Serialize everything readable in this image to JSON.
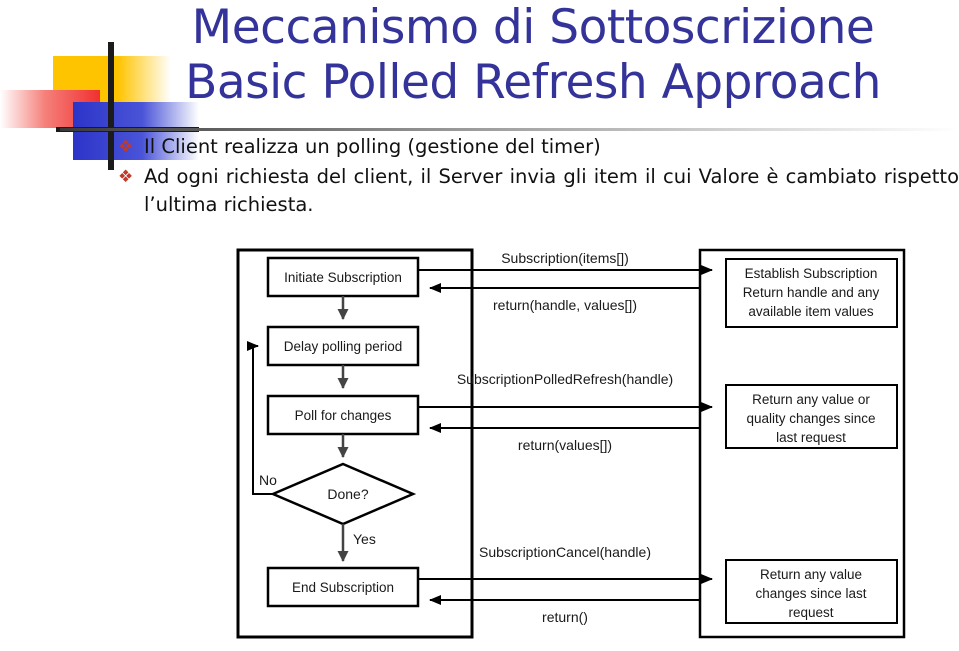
{
  "slide": {
    "title_line_1": "Meccanismo di Sottoscrizione",
    "title_line_2": "Basic Polled Refresh Approach",
    "title_color": "#333399",
    "bullet_color": "#c0392b",
    "bullets": [
      {
        "glyph": "❖",
        "text": "Il Client realizza un polling (gestione del timer)",
        "justified": false
      },
      {
        "glyph": "❖",
        "text": "Ad ogni richiesta del client, il Server invia gli item il cui Valore è cambiato rispetto l’ultima richiesta.",
        "justified": true
      }
    ]
  },
  "diagram": {
    "type": "sequence-flowchart",
    "client_steps": [
      {
        "id": "initiate",
        "label": "Initiate Subscription"
      },
      {
        "id": "delay",
        "label": "Delay polling period"
      },
      {
        "id": "poll",
        "label": "Poll for changes"
      },
      {
        "id": "end",
        "label": "End Subscription"
      }
    ],
    "decision": {
      "id": "done",
      "label": "Done?"
    },
    "branches": {
      "no": "No",
      "yes": "Yes"
    },
    "server_steps": [
      {
        "id": "establish",
        "lines": [
          "Establish Subscription",
          "Return handle and any",
          "available item values"
        ]
      },
      {
        "id": "changes",
        "lines": [
          "Return any value or",
          "quality changes since",
          "last request"
        ]
      },
      {
        "id": "cancel",
        "lines": [
          "Return any value",
          "changes since last",
          "request"
        ]
      }
    ],
    "messages": [
      {
        "id": "m1",
        "label": "Subscription(items[])",
        "direction": "request"
      },
      {
        "id": "m2",
        "label": "return(handle, values[])",
        "direction": "response"
      },
      {
        "id": "m3",
        "label": "SubscriptionPolledRefresh(handle)",
        "direction": "request"
      },
      {
        "id": "m4",
        "label": "return(values[])",
        "direction": "response"
      },
      {
        "id": "m5",
        "label": "SubscriptionCancel(handle)",
        "direction": "request"
      },
      {
        "id": "m6",
        "label": "return()",
        "direction": "response"
      }
    ]
  }
}
